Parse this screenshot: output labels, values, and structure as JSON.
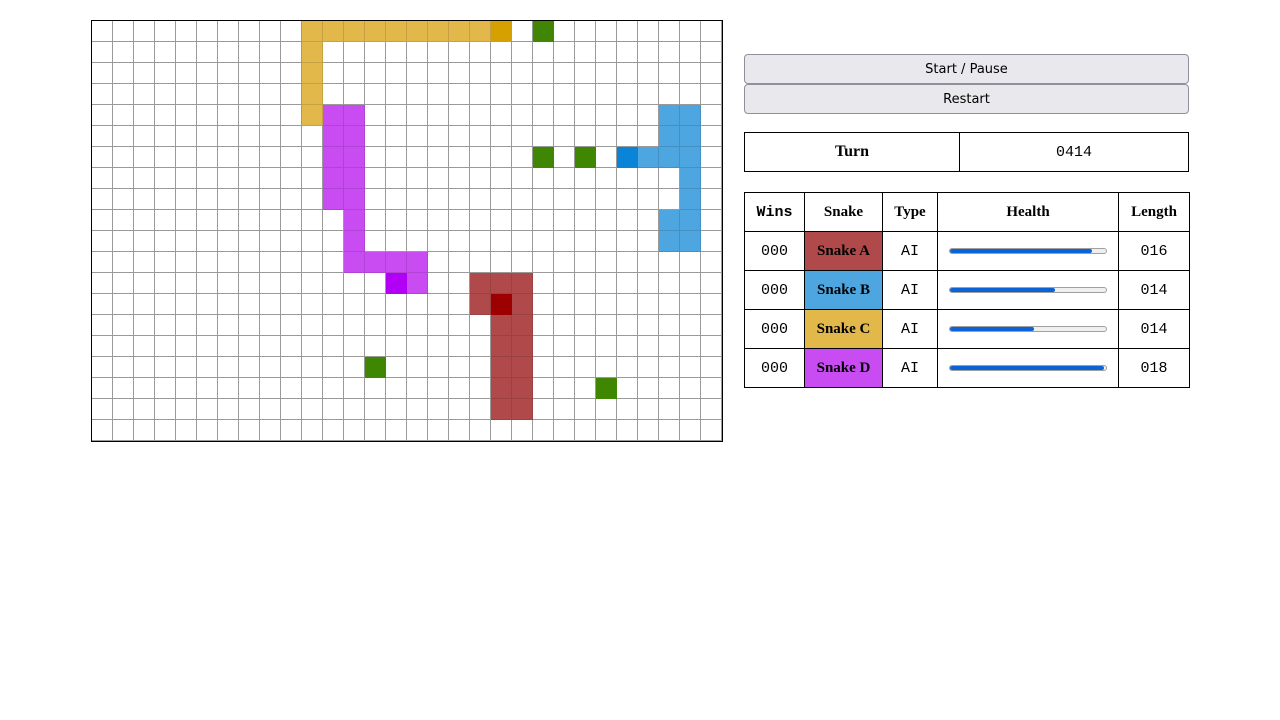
{
  "board": {
    "cols": 30,
    "rows": 20,
    "food_color": "#3f8602",
    "food": [
      [
        21,
        0
      ],
      [
        21,
        6
      ],
      [
        23,
        6
      ],
      [
        13,
        16
      ],
      [
        24,
        17
      ]
    ],
    "snakes": [
      {
        "id": "snake-a",
        "color": "#b04a4a",
        "head_color": "#9c0000",
        "head": [
          19,
          13
        ],
        "body": [
          [
            18,
            12
          ],
          [
            19,
            12
          ],
          [
            20,
            12
          ],
          [
            18,
            13
          ],
          [
            20,
            13
          ],
          [
            19,
            14
          ],
          [
            20,
            14
          ],
          [
            19,
            15
          ],
          [
            20,
            15
          ],
          [
            19,
            16
          ],
          [
            20,
            16
          ],
          [
            19,
            17
          ],
          [
            20,
            17
          ],
          [
            19,
            18
          ],
          [
            20,
            18
          ]
        ]
      },
      {
        "id": "snake-b",
        "color": "#4da6e0",
        "head_color": "#0a84d6",
        "head": [
          25,
          6
        ],
        "body": [
          [
            27,
            4
          ],
          [
            28,
            4
          ],
          [
            27,
            5
          ],
          [
            28,
            5
          ],
          [
            26,
            6
          ],
          [
            27,
            6
          ],
          [
            28,
            6
          ],
          [
            28,
            7
          ],
          [
            28,
            8
          ],
          [
            27,
            9
          ],
          [
            28,
            9
          ],
          [
            27,
            10
          ],
          [
            28,
            10
          ]
        ]
      },
      {
        "id": "snake-c",
        "color": "#e2b84b",
        "head_color": "#d6a000",
        "head": [
          19,
          0
        ],
        "body": [
          [
            10,
            0
          ],
          [
            11,
            0
          ],
          [
            12,
            0
          ],
          [
            13,
            0
          ],
          [
            14,
            0
          ],
          [
            15,
            0
          ],
          [
            16,
            0
          ],
          [
            17,
            0
          ],
          [
            18,
            0
          ],
          [
            10,
            1
          ],
          [
            10,
            2
          ],
          [
            10,
            3
          ],
          [
            10,
            4
          ]
        ]
      },
      {
        "id": "snake-d",
        "color": "#c94cf2",
        "head_color": "#b100f5",
        "head": [
          14,
          12
        ],
        "body": [
          [
            11,
            4
          ],
          [
            12,
            4
          ],
          [
            11,
            5
          ],
          [
            12,
            5
          ],
          [
            11,
            6
          ],
          [
            12,
            6
          ],
          [
            11,
            7
          ],
          [
            12,
            7
          ],
          [
            11,
            8
          ],
          [
            12,
            8
          ],
          [
            12,
            9
          ],
          [
            12,
            10
          ],
          [
            12,
            11
          ],
          [
            13,
            11
          ],
          [
            14,
            11
          ],
          [
            15,
            11
          ],
          [
            15,
            12
          ]
        ]
      }
    ]
  },
  "controls": {
    "start_pause_label": "Start / Pause",
    "restart_label": "Restart"
  },
  "turn": {
    "label": "Turn",
    "value": "0414"
  },
  "scoreboard": {
    "headers": {
      "wins": "Wins",
      "snake": "Snake",
      "type": "Type",
      "health": "Health",
      "length": "Length"
    },
    "rows": [
      {
        "wins": "000",
        "name": "Snake A",
        "color": "#b04a4a",
        "type": "AI",
        "health": 0.91,
        "length": "016"
      },
      {
        "wins": "000",
        "name": "Snake B",
        "color": "#4da6e0",
        "type": "AI",
        "health": 0.67,
        "length": "014"
      },
      {
        "wins": "000",
        "name": "Snake C",
        "color": "#e2b84b",
        "type": "AI",
        "health": 0.54,
        "length": "014"
      },
      {
        "wins": "000",
        "name": "Snake D",
        "color": "#c94cf2",
        "type": "AI",
        "health": 0.99,
        "length": "018"
      }
    ]
  }
}
